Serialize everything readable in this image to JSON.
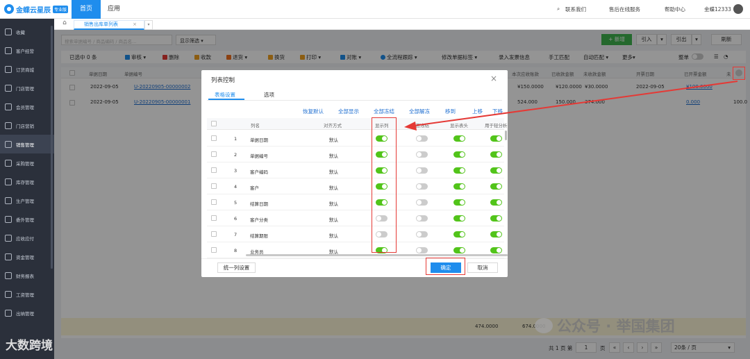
{
  "brand": {
    "name": "金蝶云星辰",
    "edition": "专业版"
  },
  "topnav": {
    "home": "首页",
    "app": "应用"
  },
  "topright": {
    "contact": "联系我们",
    "service": "售后在线服务",
    "help": "帮助中心",
    "user": "金蝶12333"
  },
  "sidebar": {
    "items": [
      {
        "label": "收藏",
        "icon": "star-icon"
      },
      {
        "label": "客户经营",
        "icon": "person-icon"
      },
      {
        "label": "订货商城",
        "icon": "cart-icon"
      },
      {
        "label": "门店管理",
        "icon": "store-icon"
      },
      {
        "label": "会员管理",
        "icon": "member-icon"
      },
      {
        "label": "门店营销",
        "icon": "promo-icon"
      },
      {
        "label": "销售管理",
        "icon": "sales-icon"
      },
      {
        "label": "采购管理",
        "icon": "purchase-icon"
      },
      {
        "label": "库存管理",
        "icon": "inventory-icon"
      },
      {
        "label": "生产管理",
        "icon": "tools-icon"
      },
      {
        "label": "委外管理",
        "icon": "outsource-icon"
      },
      {
        "label": "应收应付",
        "icon": "ar-ap-icon"
      },
      {
        "label": "资金管理",
        "icon": "money-icon"
      },
      {
        "label": "财务报表",
        "icon": "report-icon"
      },
      {
        "label": "工资管理",
        "icon": "salary-icon"
      },
      {
        "label": "出纳管理",
        "icon": "cashier-icon"
      }
    ],
    "active": "销售管理"
  },
  "tabs": {
    "active": "销售出库单列表"
  },
  "search": {
    "placeholder": "搜索单据编号 / 商品编码 / 商品名..."
  },
  "filter": {
    "label": "显示筛选"
  },
  "actions": {
    "new": "+ 新增",
    "import": "引入",
    "export": "引出",
    "refresh": "刷新"
  },
  "toolbar": {
    "selected": "已选中 0 条",
    "audit": "审核",
    "delete": "删除",
    "collect": "收款",
    "return": "退货",
    "change": "换货",
    "print": "打印",
    "reconcile": "对账",
    "track": "全流程跟踪",
    "modify": "修改单据标签",
    "invoice": "录入发票信息",
    "manual": "手工匹配",
    "auto": "自动匹配",
    "more": "更多",
    "whole": "整单"
  },
  "grid": {
    "headers": [
      "单据日期",
      "单据编号",
      "本次应收账款",
      "已收款金额",
      "未收款金额",
      "开票日期",
      "已开票金额",
      "未"
    ],
    "rows": [
      {
        "date": "2022-09-05",
        "no": "U-20220905-00000002",
        "due": "¥150.0000",
        "received": "¥120.0000",
        "unreceived": "¥30.0000",
        "invdate": "2022-09-05",
        "invoiced": "¥100.0000",
        "extra": ""
      },
      {
        "date": "2022-09-05",
        "no": "U-20220905-00000001",
        "due": "524.000",
        "received": "150.000",
        "unreceived": "374.000",
        "invdate": "",
        "invoiced": "0.000",
        "extra": "100.0"
      }
    ],
    "totals": {
      "a": "474.0000",
      "b": "674.0000"
    }
  },
  "pager": {
    "total": "共 1 页  第",
    "page": "1",
    "unit": "页",
    "size": "20条 / 页"
  },
  "dialog": {
    "title": "列表控制",
    "tabs": [
      "表格设置",
      "选项"
    ],
    "links": [
      "恢复默认",
      "全部显示",
      "全部冻结",
      "全部解冻",
      "移到",
      "上移",
      "下移"
    ],
    "headers": [
      "列名",
      "对齐方式",
      "显示列",
      "是否冻结",
      "显示表头",
      "用于轻分析"
    ],
    "rows": [
      {
        "n": "1",
        "name": "单据日期",
        "align": "默认",
        "show": true,
        "freeze": false,
        "header": true,
        "analysis": true
      },
      {
        "n": "2",
        "name": "单据编号",
        "align": "默认",
        "show": true,
        "freeze": false,
        "header": true,
        "analysis": true
      },
      {
        "n": "3",
        "name": "客户编码",
        "align": "默认",
        "show": true,
        "freeze": false,
        "header": true,
        "analysis": true
      },
      {
        "n": "4",
        "name": "客户",
        "align": "默认",
        "show": true,
        "freeze": false,
        "header": true,
        "analysis": true
      },
      {
        "n": "5",
        "name": "结算日期",
        "align": "默认",
        "show": true,
        "freeze": false,
        "header": true,
        "analysis": true
      },
      {
        "n": "6",
        "name": "客户分类",
        "align": "默认",
        "show": false,
        "freeze": false,
        "header": true,
        "analysis": true
      },
      {
        "n": "7",
        "name": "结算期限",
        "align": "默认",
        "show": false,
        "freeze": false,
        "header": true,
        "analysis": true
      },
      {
        "n": "8",
        "name": "业务员",
        "align": "默认",
        "show": true,
        "freeze": false,
        "header": true,
        "analysis": true
      }
    ],
    "unify": "统一列设置",
    "ok": "确定",
    "cancel": "取消"
  },
  "watermarks": {
    "wechat": "公众号 · 举国集团",
    "corner": "大数跨境"
  },
  "colors": {
    "primary": "#1f8ded",
    "success": "#52c41a",
    "annotation": "#e53935",
    "sidebar": "#2b303b"
  }
}
